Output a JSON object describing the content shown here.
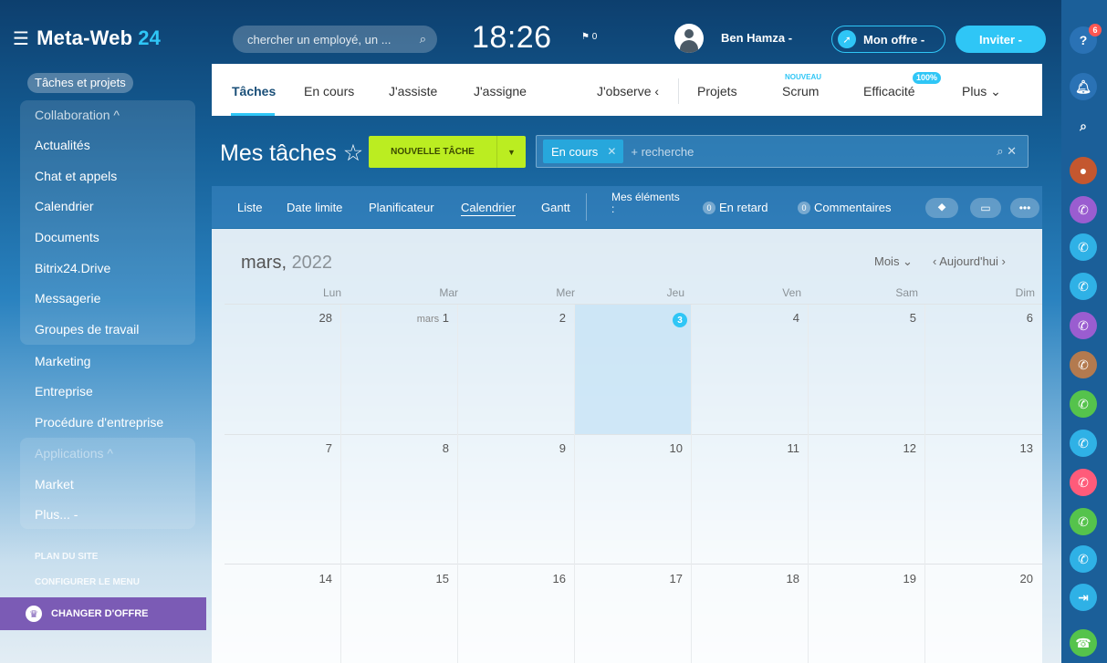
{
  "brand": {
    "menu_icon": "☰",
    "name": "Meta-Web",
    "number": "24"
  },
  "sidebar": {
    "active_item": "Tâches et projets",
    "collaboration_header": "Collaboration ^",
    "collab_items": [
      "Actualités",
      "Chat et appels",
      "Calendrier",
      "Documents",
      "Bitrix24.Drive",
      "Messagerie",
      "Groupes de travail"
    ],
    "other_items": [
      "Marketing",
      "Entreprise",
      "Procédure d'entreprise"
    ],
    "applications_header": "Applications ^",
    "app_items": [
      "Market",
      "Plus... -"
    ],
    "site_map": "PLAN DU SITE",
    "configure_menu": "CONFIGURER LE MENU",
    "change_offer": "CHANGER D'OFFRE"
  },
  "header": {
    "search_placeholder": "chercher un employé, un ...",
    "clock": "18:26",
    "flag_count": "0",
    "user_name": "Ben Hamza -",
    "offer_button": "Mon offre -",
    "invite_button": "Inviter -",
    "help_badge": "6"
  },
  "tabs": {
    "items": [
      "Tâches",
      "En cours",
      "J'assiste",
      "J'assigne",
      "J'observe ‹",
      "Projets",
      "Scrum",
      "Efficacité",
      "Plus ⌄"
    ],
    "scrum_tag": "NOUVEAU",
    "efficiency_tag": "100%"
  },
  "toolbar": {
    "title": "Mes tâches ☆",
    "new_task": "NOUVELLE TÂCHE",
    "filter_chip": "En cours",
    "filter_placeholder": "+ recherche",
    "filter_tools": "⌕  ✕"
  },
  "viewbar": {
    "views": [
      "Liste",
      "Date limite",
      "Planificateur",
      "Calendrier",
      "Gantt"
    ],
    "active_view": "Calendrier",
    "my_elements": "Mes éléments :",
    "overdue_count": "0",
    "overdue_label": "En retard",
    "comments_count": "0",
    "comments_label": "Commentaires"
  },
  "calendar": {
    "month": "mars,",
    "year": "2022",
    "mode": "Mois ⌄",
    "today_nav": "‹ Aujourd'hui ›",
    "weekdays": [
      "Lun",
      "Mar",
      "Mer",
      "Jeu",
      "Ven",
      "Sam",
      "Dim"
    ],
    "month_prefix": "mars",
    "weeks": [
      [
        "28",
        "1",
        "2",
        "3",
        "4",
        "5",
        "6"
      ],
      [
        "7",
        "8",
        "9",
        "10",
        "11",
        "12",
        "13"
      ],
      [
        "14",
        "15",
        "16",
        "17",
        "18",
        "19",
        "20"
      ]
    ],
    "today_index": [
      0,
      3
    ]
  },
  "right_rail": {
    "icons": [
      "help-icon",
      "bell-icon",
      "search-icon",
      "avatar",
      "phone-icon",
      "phone-icon",
      "phone-icon",
      "phone-icon",
      "phone-icon",
      "phone-icon",
      "phone-icon",
      "phone-icon",
      "phone-icon",
      "phone-icon",
      "door-icon",
      "call-icon"
    ],
    "colors": [
      "#2a72b5",
      "#2a72b5",
      "#1b5f99",
      "#c4572f",
      "#9a5dd0",
      "#2fb1e6",
      "#2fb1e6",
      "#9a5dd0",
      "#b37a4f",
      "#55c34c",
      "#2fb1e6",
      "#ff5b7a",
      "#55c34c",
      "#2fb1e6",
      "#2fb1e6",
      "#55c34c"
    ]
  }
}
